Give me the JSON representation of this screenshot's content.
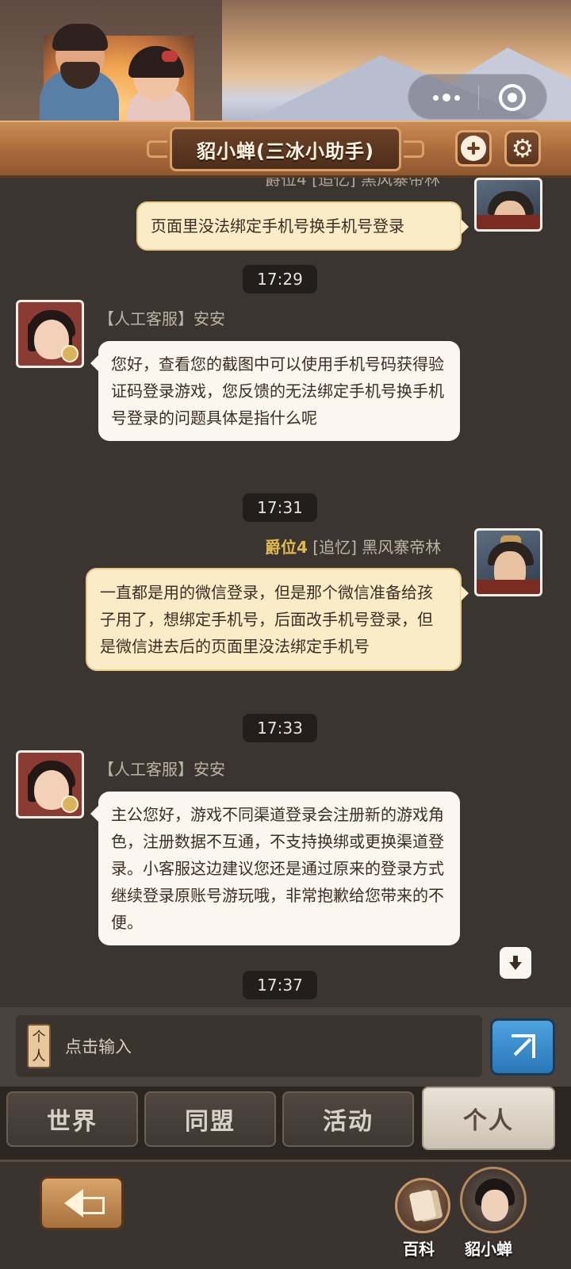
{
  "header": {
    "title": "貂小蝉(三冰小助手)",
    "add_icon": "plus-circle-icon",
    "settings_icon": "gear-icon",
    "capsule": {
      "more_icon": "more-dots-icon",
      "close_icon": "target-circle-icon"
    }
  },
  "messages": [
    {
      "id": "m1",
      "side": "right",
      "sender_partial": "爵位4 [追忆] 黑风寨帝林",
      "text": "页面里没法绑定手机号换手机号登录"
    },
    {
      "id": "t1",
      "time": "17:29"
    },
    {
      "id": "m2",
      "side": "left",
      "sender": "【人工客服】安安",
      "text": "您好，查看您的截图中可以使用手机号码获得验证码登录游戏，您反馈的无法绑定手机号换手机号登录的问题具体是指什么呢"
    },
    {
      "id": "t2",
      "time": "17:31"
    },
    {
      "id": "m3",
      "side": "right",
      "rank": "爵位4",
      "sender": "[追忆] 黑风寨帝林",
      "text": "一直都是用的微信登录，但是那个微信准备给孩子用了，想绑定手机号，后面改手机号登录，但是微信进去后的页面里没法绑定手机号"
    },
    {
      "id": "t3",
      "time": "17:33"
    },
    {
      "id": "m4",
      "side": "left",
      "sender": "【人工客服】安安",
      "text": "主公您好，游戏不同渠道登录会注册新的游戏角色，注册数据不互通，不支持换绑或更换渠道登录。小客服这边建议您还是通过原来的登录方式继续登录原账号游玩哦，非常抱歉给您带来的不便。"
    },
    {
      "id": "t4",
      "time": "17:37"
    }
  ],
  "input": {
    "tag": "个人",
    "placeholder": "点击输入",
    "send_icon": "send-arrow-icon"
  },
  "tabs": [
    {
      "label": "世界",
      "active": false
    },
    {
      "label": "同盟",
      "active": false
    },
    {
      "label": "活动",
      "active": false
    },
    {
      "label": "个人",
      "active": true
    }
  ],
  "bottom_nav": {
    "back_icon": "back-arrow-icon",
    "baike_label": "百科",
    "mascot_label": "貂小蝉"
  },
  "colors": {
    "chat_bg": "#3b3531",
    "agent_bubble": "#fbf6ef",
    "user_bubble": "#fbecc8",
    "rank_gold": "#e2b851",
    "send_blue": "#2a77b8"
  }
}
